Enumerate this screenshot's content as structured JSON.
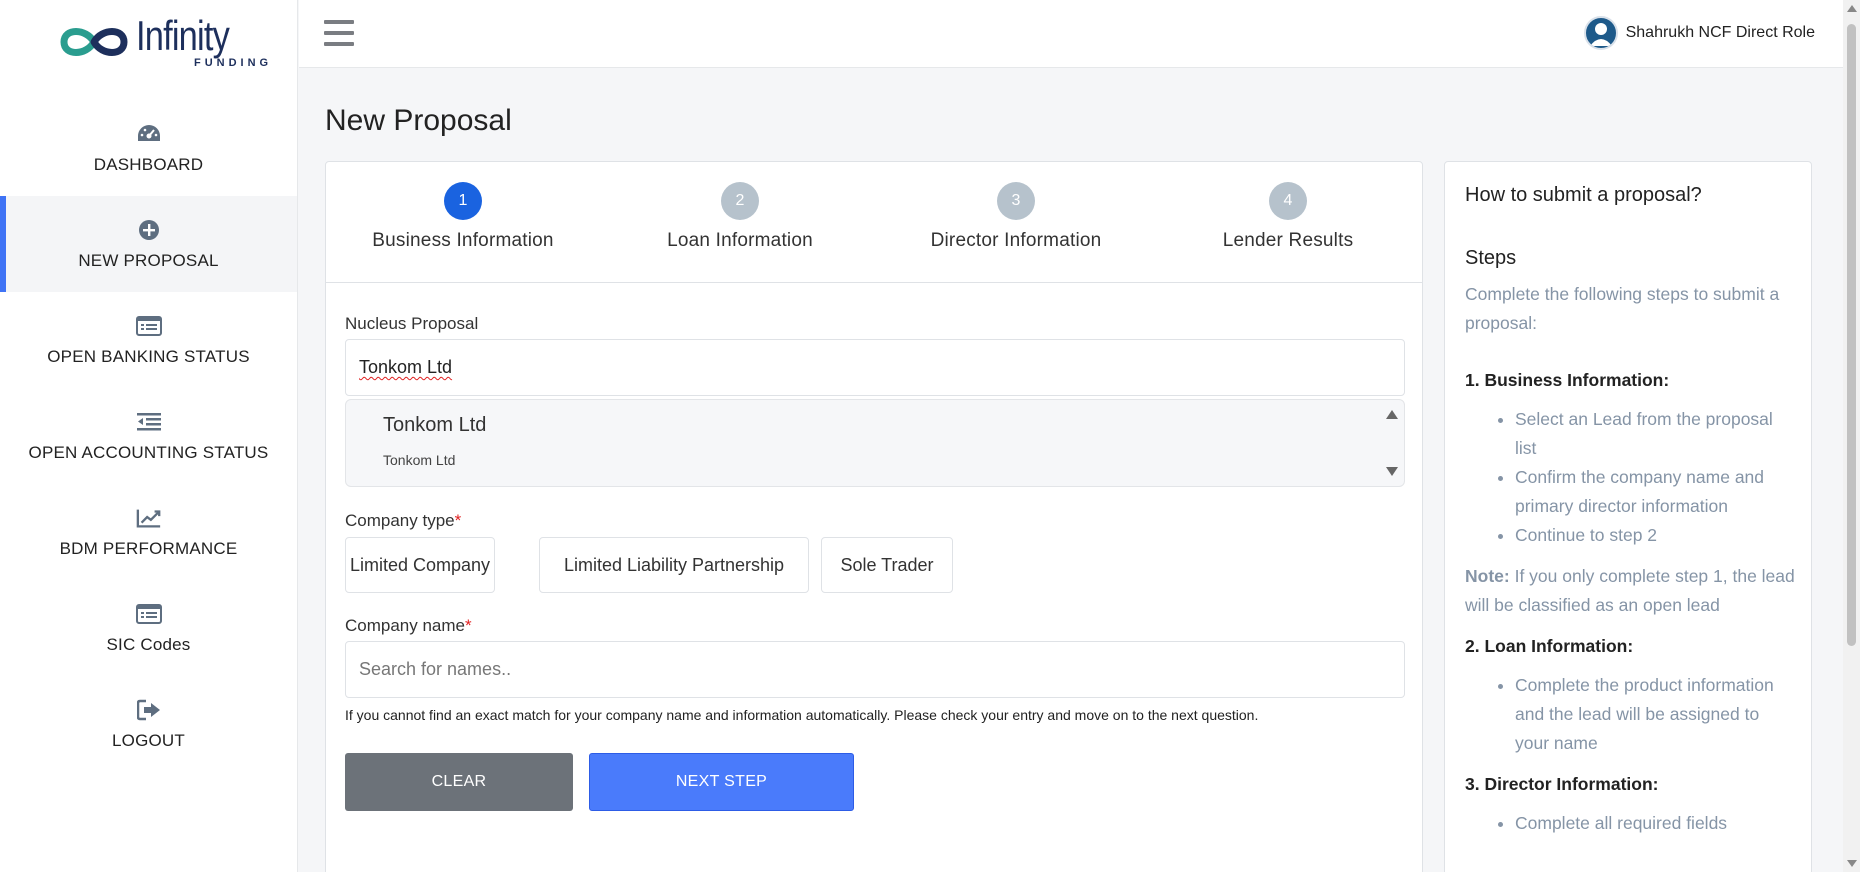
{
  "brand": {
    "name": "Infinity",
    "sub": "FUNDING",
    "accent": "#3f73f5"
  },
  "sidebar": {
    "items": [
      {
        "label": "DASHBOARD",
        "icon": "dashboard-icon"
      },
      {
        "label": "NEW PROPOSAL",
        "icon": "plus-circle-icon",
        "active": true
      },
      {
        "label": "OPEN BANKING STATUS",
        "icon": "list-card-icon"
      },
      {
        "label": "OPEN ACCOUNTING STATUS",
        "icon": "indent-list-icon"
      },
      {
        "label": "BDM PERFORMANCE",
        "icon": "line-chart-icon"
      },
      {
        "label": "SIC Codes",
        "icon": "list-card-icon"
      },
      {
        "label": "LOGOUT",
        "icon": "logout-icon"
      }
    ]
  },
  "header": {
    "user_name": "Shahrukh NCF Direct Role"
  },
  "page": {
    "title": "New Proposal"
  },
  "steps": [
    {
      "number": "1",
      "label": "Business Information",
      "active": true
    },
    {
      "number": "2",
      "label": "Loan Information"
    },
    {
      "number": "3",
      "label": "Director Information"
    },
    {
      "number": "4",
      "label": "Lender Results"
    }
  ],
  "form": {
    "nucleus_label": "Nucleus Proposal",
    "nucleus_value": "Tonkom Ltd",
    "suggestion": {
      "main": "Tonkom Ltd",
      "sub": "Tonkom Ltd"
    },
    "company_type_label": "Company type",
    "required_mark": "*",
    "company_types": [
      "Limited Company",
      "Limited Liability Partnership",
      "Sole Trader"
    ],
    "company_name_label": "Company name",
    "company_name_placeholder": "Search for names..",
    "help_text": "If you cannot find an exact match for your company name and information automatically. Please check your entry and move on to the next question.",
    "clear_label": "CLEAR",
    "next_label": "NEXT STEP"
  },
  "help": {
    "title": "How to submit a proposal?",
    "steps_heading": "Steps",
    "intro": "Complete the following steps to submit a proposal:",
    "sec1_title": "1. Business Information:",
    "sec1_items": [
      "Select an Lead from the proposal list",
      "Confirm the company name and primary director information",
      "Continue to step 2"
    ],
    "note_label": "Note:",
    "note_text": " If you only complete step 1, the lead will be classified as an open lead",
    "sec2_title": "2. Loan Information:",
    "sec2_items": [
      "Complete the product information and the lead will be assigned to your name"
    ],
    "sec3_title": "3. Director Information:",
    "sec3_items": [
      "Complete all required fields"
    ]
  }
}
